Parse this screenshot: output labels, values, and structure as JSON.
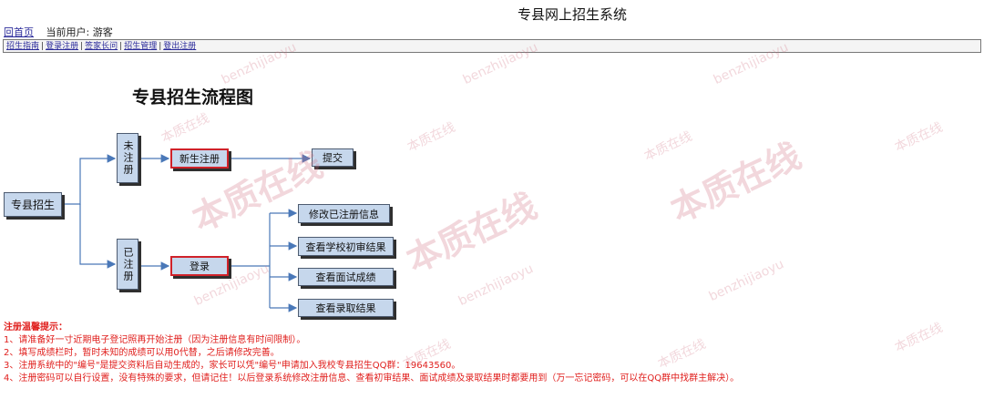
{
  "header": {
    "site_title": "专县网上招生系统",
    "home_link": "回首页",
    "current_user": "当前用户: 游客"
  },
  "nav": {
    "items": [
      "招生指南",
      "登录注册",
      "签家长问",
      "招生管理",
      "登出注册"
    ]
  },
  "flow": {
    "title": "专县招生流程图",
    "root": "专县招生",
    "unregistered": "未注册",
    "registered": "已注册",
    "new_register": "新生注册",
    "submit": "提交",
    "login": "登录",
    "actions": [
      "修改已注册信息",
      "查看学校初审结果",
      "查看面试成绩",
      "查看录取结果"
    ]
  },
  "notice": {
    "heading": "注册温馨提示：",
    "lines": [
      "1、请准备好一寸近期电子登记照再开始注册（因为注册信息有时间限制）。",
      "2、填写成绩栏时，暂时未知的成绩可以用0代替，之后请修改完善。",
      "3、注册系统中的\"编号\"是提交资料后自动生成的，家长可以凭\"编号\"申请加入我校专县招生QQ群：19643560。",
      "4、注册密码可以自行设置，没有特殊的要求，但请记住！以后登录系统修改注册信息、查看初审结果、面试成绩及录取结果时都要用到（万一忘记密码，可以在QQ群中找群主解决）。"
    ]
  },
  "watermark": {
    "pinyin": "benzhijiaoyu",
    "cn": "本质在线"
  },
  "colors": {
    "box_fill": "#c6d7ec",
    "highlight_border": "#d0222a",
    "notice": "#e0201e",
    "link": "#2a2a9a"
  }
}
